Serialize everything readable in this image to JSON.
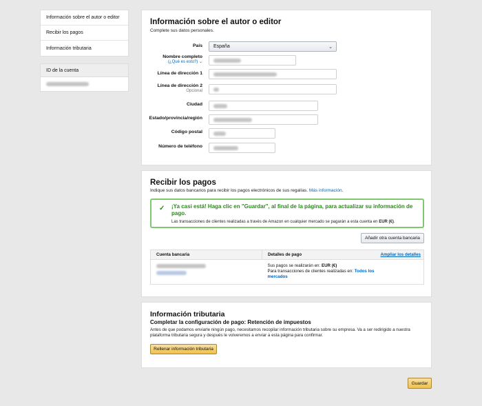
{
  "sidebar": {
    "items": [
      {
        "label": "Información sobre el autor o editor"
      },
      {
        "label": "Recibir los pagos"
      },
      {
        "label": "Información tributaria"
      }
    ],
    "account_heading": "ID de la cuenta"
  },
  "author": {
    "title": "Información sobre el autor o editor",
    "subtitle": "Complete sus datos personales.",
    "country_label": "País",
    "country_value": "España",
    "name_label": "Nombre completo",
    "name_help": "(¿Qué es esto?)",
    "addr1_label": "Línea de dirección 1",
    "addr2_label": "Línea de dirección 2",
    "addr2_optional": "Opcional",
    "city_label": "Ciudad",
    "state_label": "Estado/provincia/región",
    "zip_label": "Código postal",
    "phone_label": "Número de teléfono"
  },
  "payments": {
    "title": "Recibir los pagos",
    "subtitle": "Indique sus datos bancarios para recibir los pagos electrónicos de sus regalías.",
    "more_info": "Más información",
    "alert_message": "¡Ya casi está! Haga clic en \"Guardar\", al final de la página, para actualizar su información de pago.",
    "alert_note_prefix": "Las transacciones de clientes realizadas a través de Amazon en cualquier mercado se pagarán a esta cuenta en ",
    "alert_note_currency": "EUR (€)",
    "alert_note_suffix": ".",
    "add_account_button": "Añadir otra cuenta bancaria",
    "col_bank": "Cuenta bancaria",
    "col_details": "Detalles de pago",
    "expand_details": "Ampliar los detalles",
    "payout_prefix": "Sus pagos se realizarán en: ",
    "payout_currency": "EUR (€)",
    "transactions_prefix": "Para transacciones de clientes realizadas en: ",
    "transactions_markets": "Todos los mercados"
  },
  "tax": {
    "title": "Información tributaria",
    "subtitle": "Completar la configuración de pago: Retención de impuestos",
    "body": "Antes de que podamos enviarle ningún pago, necesitamos recopilar información tributaria sobre su empresa. Va a ser redirigido a nuestra plataforma tributaria segura y después le volveremos a enviar a esta página para confirmar.",
    "button": "Rellenar información tributaria"
  },
  "footer": {
    "save_button": "Guardar"
  }
}
